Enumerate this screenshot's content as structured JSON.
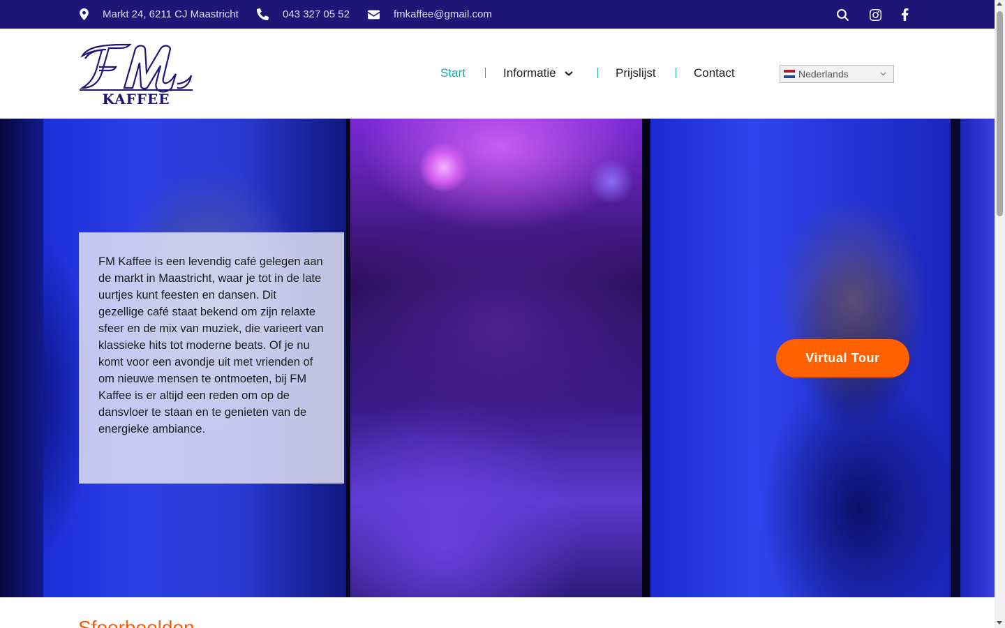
{
  "topbar": {
    "address": "Markt 24, 6211 CJ Maastricht",
    "phone": "043 327 05 52",
    "email": "fmkaffee@gmail.com",
    "icons": [
      "map-marker-icon",
      "phone-icon",
      "envelope-icon",
      "search-icon",
      "instagram-icon",
      "facebook-icon"
    ]
  },
  "logo": {
    "line1": "FM",
    "line2": "KAFFEE"
  },
  "nav": {
    "items": [
      {
        "label": "Start",
        "active": true
      },
      {
        "label": "Informatie",
        "has_dropdown": true
      },
      {
        "label": "Prijslijst"
      },
      {
        "label": "Contact"
      }
    ]
  },
  "language": {
    "selected": "Nederlands"
  },
  "hero": {
    "text": "FM Kaffee is een levendig café gelegen aan de markt in Maastricht, waar je tot in de late uurtjes kunt feesten en dansen. Dit gezellige café staat bekend om zijn relaxte sfeer en de mix van muziek, die varieert van klassieke hits tot moderne beats. Of je nu komt voor een avondje uit met vrienden of om nieuwe mensen te ontmoeten, bij FM Kaffee is er altijd een reden om op de dansvloer te staan en te genieten van de energieke ambiance.",
    "button": "Virtual Tour"
  },
  "section": {
    "title": "Sfeerbeelden"
  },
  "colors": {
    "topbar_bg": "#1f1577",
    "active_nav": "#1aa8a2",
    "accent_orange": "#ff6100",
    "logo_blue": "#1f1577"
  }
}
